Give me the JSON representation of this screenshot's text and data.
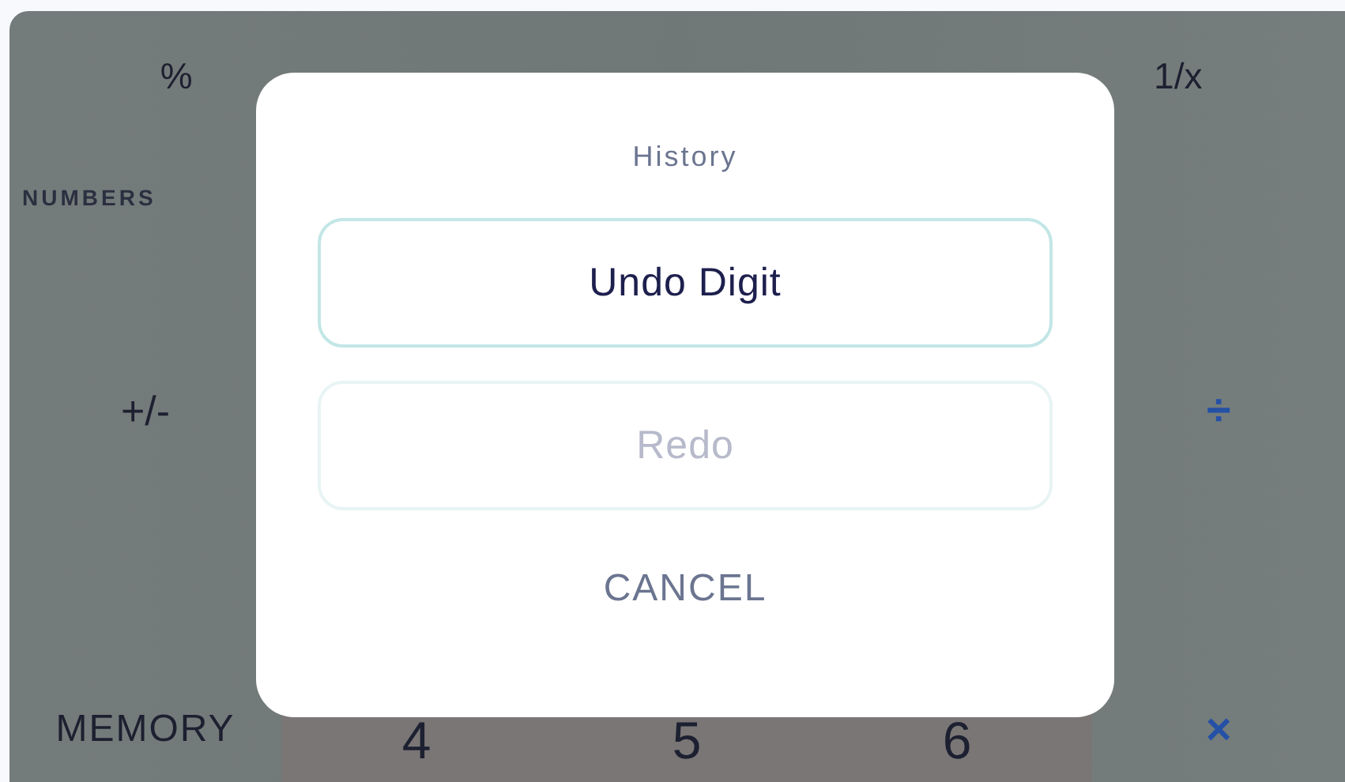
{
  "calculator": {
    "rows": [
      [
        {
          "label": "%",
          "kind": "function"
        },
        {
          "kind": "blank"
        },
        {
          "kind": "blank"
        },
        {
          "label": "1/x",
          "kind": "function"
        }
      ],
      [
        {
          "label": "NUMBERS",
          "kind": "section"
        }
      ],
      [
        {
          "label": "+/-",
          "kind": "function"
        },
        {
          "kind": "blank"
        },
        {
          "kind": "blank"
        },
        {
          "kind": "blank"
        },
        {
          "label": "÷",
          "kind": "operator"
        }
      ],
      [
        {
          "label": "MEMORY",
          "kind": "memory"
        },
        {
          "label": "4",
          "kind": "digit"
        },
        {
          "label": "5",
          "kind": "digit"
        },
        {
          "label": "6",
          "kind": "digit"
        },
        {
          "label": "×",
          "kind": "operator"
        }
      ]
    ]
  },
  "dialog": {
    "title": "History",
    "actions": [
      {
        "label": "Undo Digit",
        "disabled": false
      },
      {
        "label": "Redo",
        "disabled": true
      }
    ],
    "cancel": "CANCEL"
  }
}
